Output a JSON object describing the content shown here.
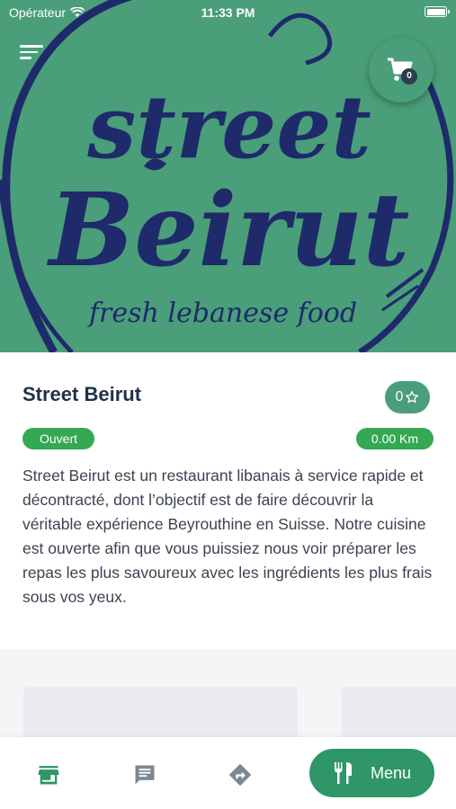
{
  "status_bar": {
    "carrier": "Opérateur",
    "time": "11:33 PM"
  },
  "hero": {
    "logo_word1": "street",
    "logo_word2": "Beirut",
    "tagline": "fresh lebanese food"
  },
  "header": {
    "cart_count": "0"
  },
  "restaurant": {
    "name": "Street Beirut",
    "rating": "0",
    "status": "Ouvert",
    "distance": "0.00 Km",
    "description": "Street Beirut est un restaurant libanais à service rapide et décontracté, dont l’objectif est de faire découvrir la véritable expérience Beyrouthine en Suisse. Notre cuisine est ouverte afin que vous puissiez nous voir préparer les repas les plus savoureux avec les ingrédients les plus frais sous vos yeux."
  },
  "bottom_nav": {
    "menu_label": "Menu"
  },
  "colors": {
    "brand": "#4a9e79",
    "accent": "#2e9668",
    "open": "#34a853",
    "logo": "#1f2a6b",
    "title": "#1f3048"
  }
}
